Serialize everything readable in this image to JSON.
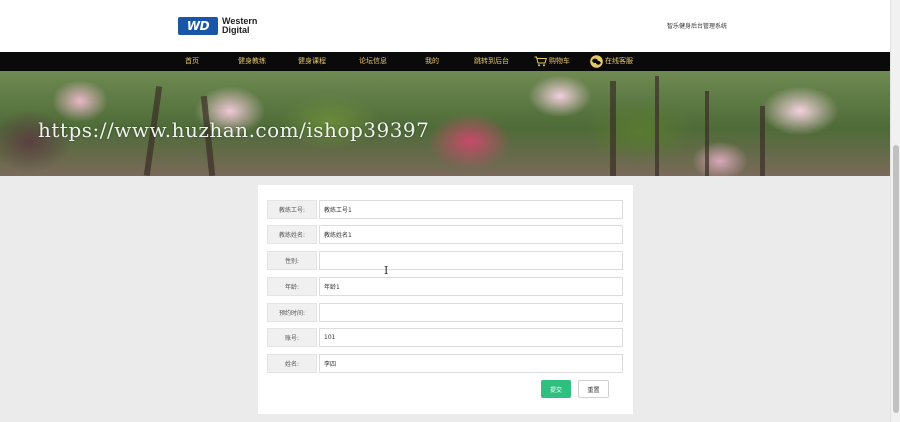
{
  "header": {
    "logo_line1": "Western",
    "logo_line2": "Digital",
    "logo_mark": "WD",
    "system_title": "智乐健身后台管理系统"
  },
  "nav": {
    "items": [
      {
        "label": "首页"
      },
      {
        "label": "健身教练"
      },
      {
        "label": "健身课程"
      },
      {
        "label": "论坛信息"
      },
      {
        "label": "我的"
      },
      {
        "label": "跳转到后台"
      },
      {
        "label": "购物车",
        "icon": "cart-icon"
      },
      {
        "label": "在线客服",
        "icon": "chat-icon"
      }
    ],
    "text_color": "#e6c86a",
    "background": "#0a0a0a"
  },
  "banner": {
    "watermark": "https://www.huzhan.com/ishop39397"
  },
  "form": {
    "fields": [
      {
        "label": "教练工号:",
        "value": "教练工号1"
      },
      {
        "label": "教练姓名:",
        "value": "教练姓名1"
      },
      {
        "label": "性别:",
        "value": ""
      },
      {
        "label": "年龄:",
        "value": "年龄1"
      },
      {
        "label": "预约时间:",
        "value": ""
      },
      {
        "label": "账号:",
        "value": "101"
      },
      {
        "label": "姓名:",
        "value": "李四"
      }
    ],
    "submit_label": "提交",
    "reset_label": "重置",
    "accent_color": "#2fbf7f"
  }
}
